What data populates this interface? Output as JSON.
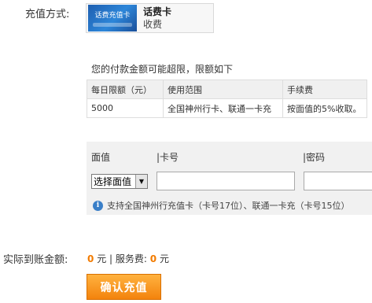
{
  "payment": {
    "label": "充值方式:",
    "card_image_text": "话费充值卡",
    "card_name": "话费卡",
    "card_sub": "收费"
  },
  "notice": "您的付款金额可能超限，限额如下",
  "limit_table": {
    "headers": [
      "每日限额（元）",
      "使用范围",
      "手续费"
    ],
    "rows": [
      [
        "5000",
        "全国神州行卡、联通一卡充",
        "按面值的5%收取。"
      ]
    ]
  },
  "form": {
    "face_value_label": "面值",
    "card_no_label": "|卡号",
    "password_label": "|密码",
    "select_value": "选择面值",
    "tip": "支持全国神州行充值卡（卡号17位）、联通一卡充（卡号15位）"
  },
  "amount": {
    "label": "实际到账金额:",
    "value": "0",
    "unit": "元",
    "fee_label": "| 服务费:",
    "fee_value": "0",
    "fee_unit": "元"
  },
  "confirm_button": "确认充值",
  "colors": {
    "accent": "#f27b00",
    "button": "#f3830d",
    "info": "#3a7fc8"
  },
  "icons": {
    "tip": "info-icon",
    "select": "triangle-down-icon"
  }
}
